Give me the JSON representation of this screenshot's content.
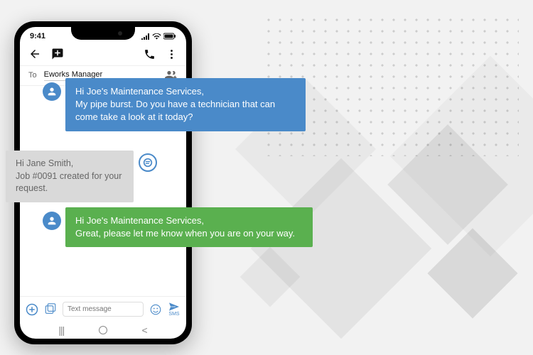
{
  "status": {
    "time": "9:41"
  },
  "header": {
    "to_label": "To",
    "contact": "Eworks Manager"
  },
  "messages": {
    "m1": "Hi Joe's Maintenance Services,\nMy pipe burst. Do you have a technician that can come take a look at it today?",
    "m2": "Hi Jane Smith,\nJob #0091 created for your request.",
    "m3": "Hi Joe's Maintenance Services,\nGreat, please let me know when you are on your way."
  },
  "composer": {
    "placeholder": "Text message",
    "send_label": "SMS"
  },
  "colors": {
    "blue": "#4a8ac9",
    "green": "#5ab04f",
    "grey": "#d9d9d9"
  }
}
